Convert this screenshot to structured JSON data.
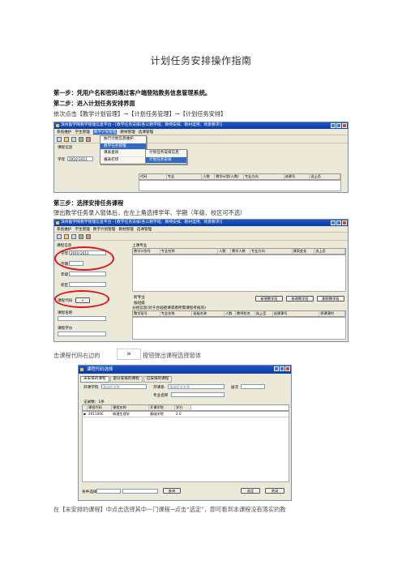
{
  "doc": {
    "title": "计划任务安排操作指南",
    "step1": "第一步：凭用户名和密码通过客户端登陆教务信息管理系统。",
    "step2": "第二步：进入计划任务安排界面",
    "step2_path": "依次点击【教学计划管理】→【计划任务管理】→【计划任务安排】",
    "step3": "第三步：选择安排任务课程",
    "step3_desc": "弹出教学任务录入窗体后，在左上角选择学年、学期（年级、校区可不选）",
    "click_prefix": "击课程代码右边的",
    "arrow_glyph": "»",
    "click_suffix": "按钮弹出课程选择窗体",
    "last_line": "在【未安排的课程】中点击选择其中一门课程→点击“选定”，即可看到本课程没有落实的教"
  },
  "shot1": {
    "title": "滨州医学院教学管理信息平台 - [教学任务安排(各公教学班、教师安排、教材选用、场景要求)]",
    "menu": [
      "系统维护",
      "学生管理",
      "教学计划管理",
      "教材管理",
      "选课管理"
    ],
    "tab_label": "课程信息",
    "year_label": "学年",
    "year_value": "2010-2011",
    "headers": [
      "代码",
      "专业",
      "人数",
      "教学计划(人数)",
      "专业方向",
      "选课号",
      "选上否"
    ],
    "dropdown_main": [
      "执行计划信息维护",
      "教学任务管理",
      "课表查询",
      "报表打印"
    ],
    "dropdown_sub": [
      "计划任务安排信息",
      "计划任务安排"
    ]
  },
  "shot2": {
    "title": "滨州医学院教学管理信息平台 - [教学任务安排(各公教学班、教师安排、教材选用、场景要求)]",
    "menu": [
      "系统维护",
      "学生管理",
      "教学计划管理",
      "教材管理",
      "选课管理"
    ],
    "left_header": "课程信息",
    "year_label": "学年",
    "year_value": "2010-2011",
    "term_label": "学期",
    "grade_label": "年级",
    "campus_label": "校区",
    "code_label": "课程代码",
    "code_btn": "»",
    "name_label": "课程名称",
    "credit_label": "课程学分",
    "right_header": "上课专业",
    "grid1": [
      "教学计划号",
      "专业名称",
      "人数",
      "教学人数",
      "专业方向",
      "课表变化",
      "选上否"
    ],
    "check1": "跨专业",
    "check2": "按班级",
    "btn1": "新增教学班",
    "btn2": "修改教学班",
    "btn3": "删除教学班",
    "subtitle": "分组信息(对于合班授课或者所需课程考核的)",
    "grid2": [
      "教学班号",
      "专业名称",
      "班级名称",
      "人数",
      "教师姓名",
      "选上否",
      "选课课号",
      "授课课时"
    ]
  },
  "shot3": {
    "title": "课程代码选择",
    "tabs": [
      "未安排的课程",
      "部分安排的课程",
      "已安排的课程"
    ],
    "college_label": "开课学院",
    "college_value": "基础医学院",
    "dept_label": "开课系",
    "dept_value": "基础医学学系",
    "level_label": "层次",
    "major_label": "专业名称",
    "count_label": "记录数：1条",
    "headers": [
      "课程代码",
      "课程名称",
      "开课学院",
      "学分"
    ],
    "row": [
      "201100C",
      "病理生理学",
      "基础学院",
      "2.0"
    ],
    "cond_label": "条件选择",
    "query_btn": "查询",
    "ok_btn": "选定",
    "close_btn": "关闭"
  },
  "colors": {
    "titlebar": "#0a3aa8",
    "highlight": "#316ac5",
    "ring": "#e0141a"
  }
}
